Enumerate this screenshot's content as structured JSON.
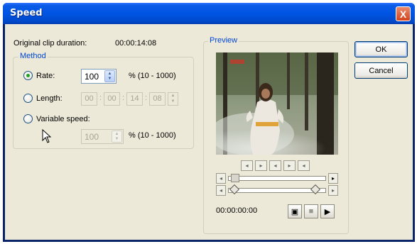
{
  "window": {
    "title": "Speed",
    "close_label": "X"
  },
  "info": {
    "original_label": "Original clip duration:",
    "original_value": "00:00:14:08"
  },
  "method": {
    "legend": "Method",
    "rate": {
      "label": "Rate:",
      "value": "100",
      "range": "% (10 - 1000)"
    },
    "length": {
      "label": "Length:",
      "hh": "00",
      "mm": "00",
      "ss": "14",
      "ff": "08"
    },
    "variable": {
      "label": "Variable speed:",
      "value": "100",
      "range": "% (10 - 1000)"
    },
    "selected": "rate"
  },
  "preview": {
    "legend": "Preview",
    "timecode": "00:00:00:00"
  },
  "buttons": {
    "ok": "OK",
    "cancel": "Cancel"
  }
}
